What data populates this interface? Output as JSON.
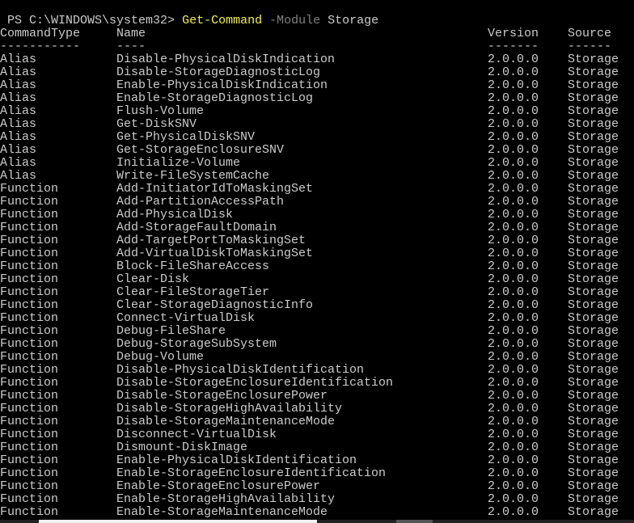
{
  "prompt": {
    "ps": "PS C:\\WINDOWS\\system32> ",
    "cmd": "Get-Command",
    "param": " -Module",
    "arg": " Storage"
  },
  "headers": [
    "CommandType",
    "Name",
    "Version",
    "Source"
  ],
  "underlines": [
    "-----------",
    "----",
    "-------",
    "------"
  ],
  "rows": [
    [
      "Alias",
      "Disable-PhysicalDiskIndication",
      "2.0.0.0",
      "Storage"
    ],
    [
      "Alias",
      "Disable-StorageDiagnosticLog",
      "2.0.0.0",
      "Storage"
    ],
    [
      "Alias",
      "Enable-PhysicalDiskIndication",
      "2.0.0.0",
      "Storage"
    ],
    [
      "Alias",
      "Enable-StorageDiagnosticLog",
      "2.0.0.0",
      "Storage"
    ],
    [
      "Alias",
      "Flush-Volume",
      "2.0.0.0",
      "Storage"
    ],
    [
      "Alias",
      "Get-DiskSNV",
      "2.0.0.0",
      "Storage"
    ],
    [
      "Alias",
      "Get-PhysicalDiskSNV",
      "2.0.0.0",
      "Storage"
    ],
    [
      "Alias",
      "Get-StorageEnclosureSNV",
      "2.0.0.0",
      "Storage"
    ],
    [
      "Alias",
      "Initialize-Volume",
      "2.0.0.0",
      "Storage"
    ],
    [
      "Alias",
      "Write-FileSystemCache",
      "2.0.0.0",
      "Storage"
    ],
    [
      "Function",
      "Add-InitiatorIdToMaskingSet",
      "2.0.0.0",
      "Storage"
    ],
    [
      "Function",
      "Add-PartitionAccessPath",
      "2.0.0.0",
      "Storage"
    ],
    [
      "Function",
      "Add-PhysicalDisk",
      "2.0.0.0",
      "Storage"
    ],
    [
      "Function",
      "Add-StorageFaultDomain",
      "2.0.0.0",
      "Storage"
    ],
    [
      "Function",
      "Add-TargetPortToMaskingSet",
      "2.0.0.0",
      "Storage"
    ],
    [
      "Function",
      "Add-VirtualDiskToMaskingSet",
      "2.0.0.0",
      "Storage"
    ],
    [
      "Function",
      "Block-FileShareAccess",
      "2.0.0.0",
      "Storage"
    ],
    [
      "Function",
      "Clear-Disk",
      "2.0.0.0",
      "Storage"
    ],
    [
      "Function",
      "Clear-FileStorageTier",
      "2.0.0.0",
      "Storage"
    ],
    [
      "Function",
      "Clear-StorageDiagnosticInfo",
      "2.0.0.0",
      "Storage"
    ],
    [
      "Function",
      "Connect-VirtualDisk",
      "2.0.0.0",
      "Storage"
    ],
    [
      "Function",
      "Debug-FileShare",
      "2.0.0.0",
      "Storage"
    ],
    [
      "Function",
      "Debug-StorageSubSystem",
      "2.0.0.0",
      "Storage"
    ],
    [
      "Function",
      "Debug-Volume",
      "2.0.0.0",
      "Storage"
    ],
    [
      "Function",
      "Disable-PhysicalDiskIdentification",
      "2.0.0.0",
      "Storage"
    ],
    [
      "Function",
      "Disable-StorageEnclosureIdentification",
      "2.0.0.0",
      "Storage"
    ],
    [
      "Function",
      "Disable-StorageEnclosurePower",
      "2.0.0.0",
      "Storage"
    ],
    [
      "Function",
      "Disable-StorageHighAvailability",
      "2.0.0.0",
      "Storage"
    ],
    [
      "Function",
      "Disable-StorageMaintenanceMode",
      "2.0.0.0",
      "Storage"
    ],
    [
      "Function",
      "Disconnect-VirtualDisk",
      "2.0.0.0",
      "Storage"
    ],
    [
      "Function",
      "Dismount-DiskImage",
      "2.0.0.0",
      "Storage"
    ],
    [
      "Function",
      "Enable-PhysicalDiskIdentification",
      "2.0.0.0",
      "Storage"
    ],
    [
      "Function",
      "Enable-StorageEnclosureIdentification",
      "2.0.0.0",
      "Storage"
    ],
    [
      "Function",
      "Enable-StorageEnclosurePower",
      "2.0.0.0",
      "Storage"
    ],
    [
      "Function",
      "Enable-StorageHighAvailability",
      "2.0.0.0",
      "Storage"
    ],
    [
      "Function",
      "Enable-StorageMaintenanceMode",
      "2.0.0.0",
      "Storage"
    ]
  ]
}
